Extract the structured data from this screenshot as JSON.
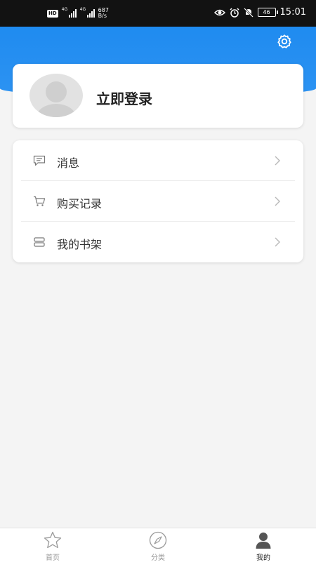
{
  "status_bar": {
    "hd_label": "HD",
    "signal_1_label": "4G",
    "signal_2_label": "4G",
    "speed_value": "687",
    "speed_unit": "B/s",
    "battery_level": "46",
    "time": "15:01"
  },
  "header": {
    "settings_icon": "gear-icon",
    "accent_color": "#1f8bf0"
  },
  "profile": {
    "login_label": "立即登录",
    "avatar_icon": "default-avatar-icon"
  },
  "menu": {
    "items": [
      {
        "label": "消息",
        "icon": "message-icon"
      },
      {
        "label": "购买记录",
        "icon": "cart-icon"
      },
      {
        "label": "我的书架",
        "icon": "bookshelf-icon"
      }
    ]
  },
  "tab_bar": {
    "tabs": [
      {
        "label": "首页",
        "icon": "star-icon",
        "active": false
      },
      {
        "label": "分类",
        "icon": "compass-icon",
        "active": false
      },
      {
        "label": "我的",
        "icon": "person-icon",
        "active": true
      }
    ]
  }
}
